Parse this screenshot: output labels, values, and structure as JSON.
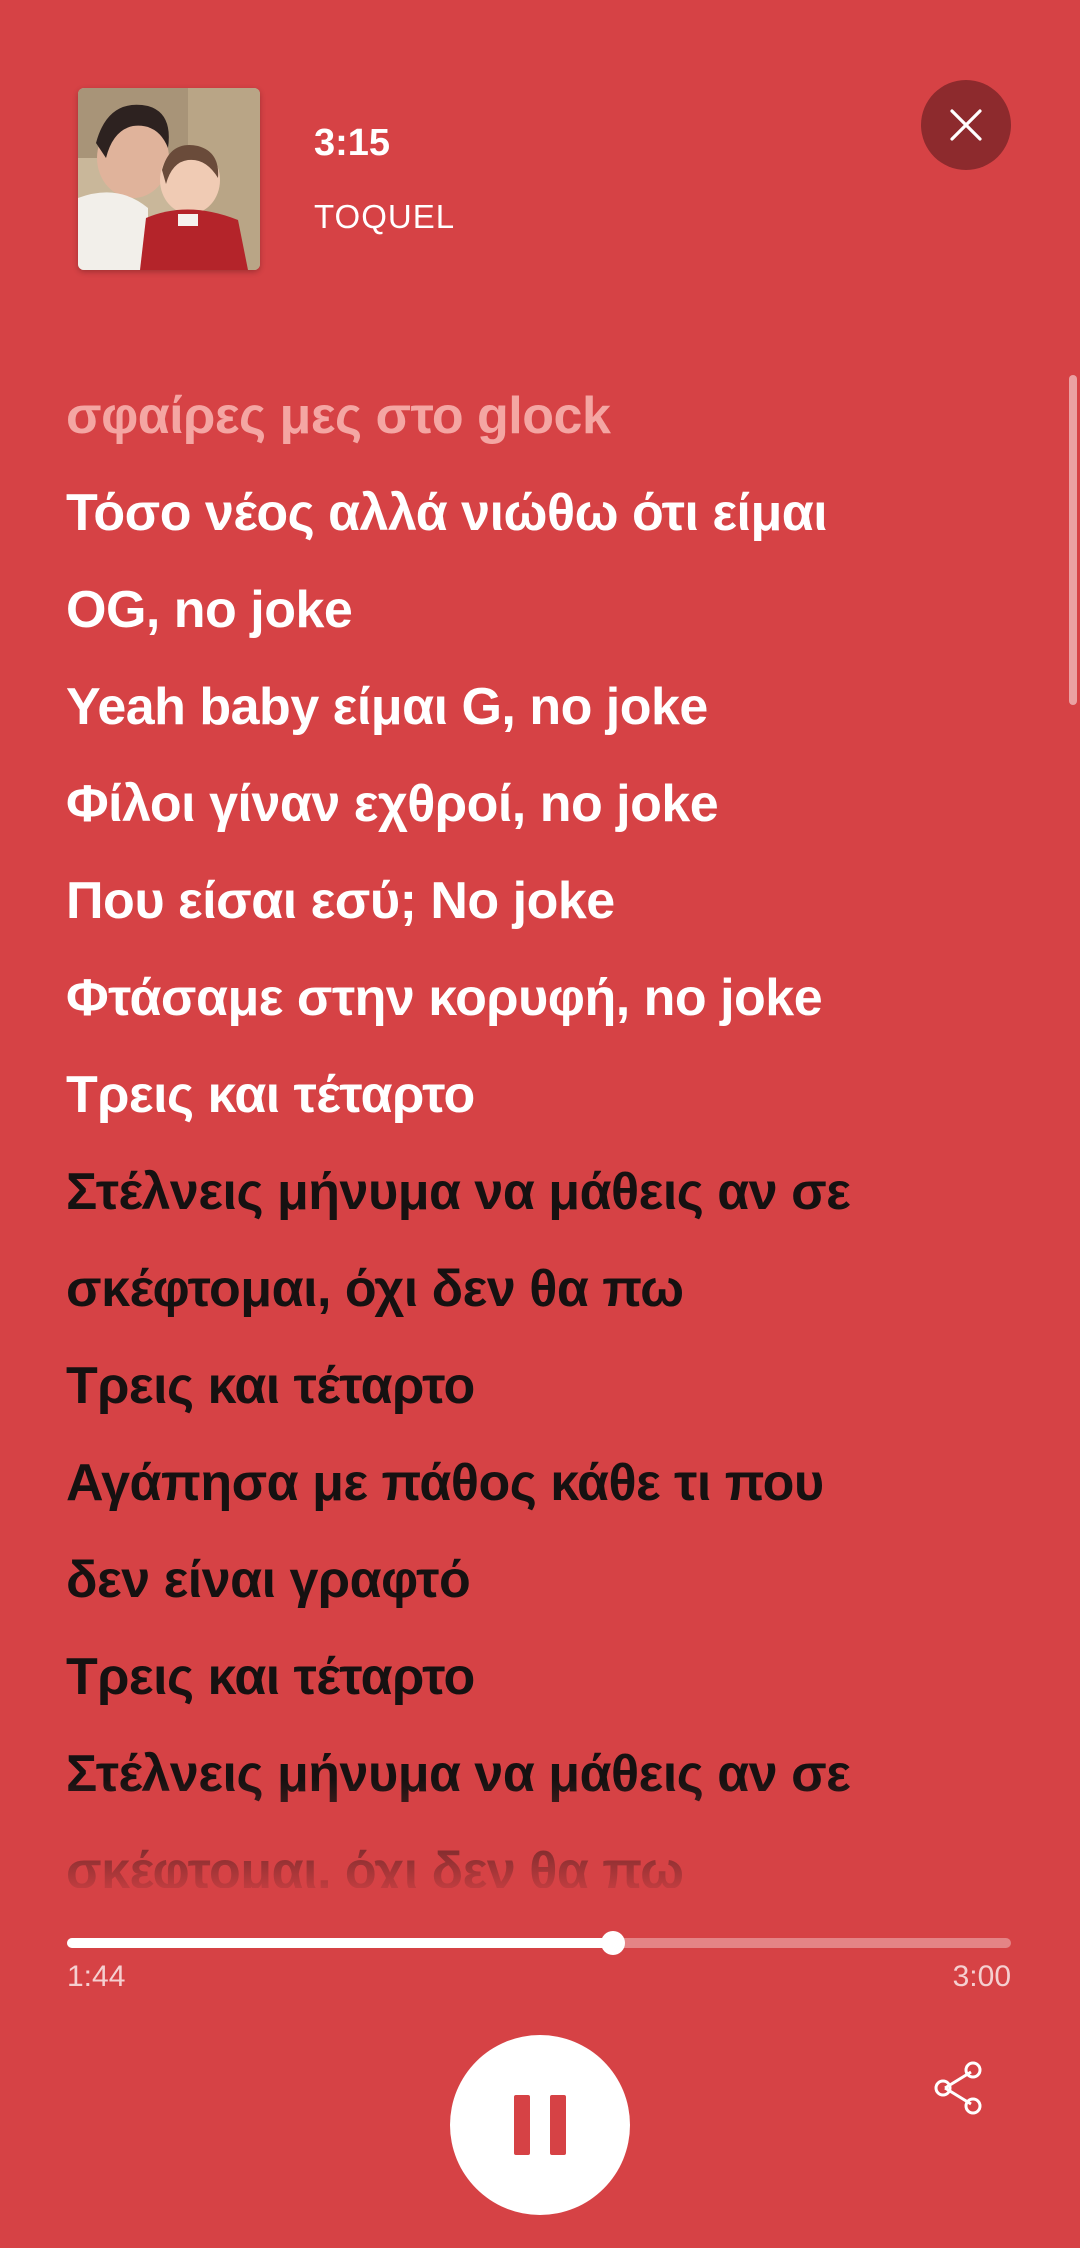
{
  "track": {
    "title": "3:15",
    "artist": "TOQUEL"
  },
  "icons": {
    "close": "close-icon",
    "pause": "pause-icon",
    "share": "share-icon"
  },
  "colors": {
    "background": "#d64245",
    "close_button": "#8d2a2d",
    "past_lyric": "#ffffff",
    "upcoming_lyric": "#161111",
    "faded_lyric": "#f4a6a3"
  },
  "lyrics": [
    {
      "text": "σφαίρες μες στο glock",
      "state": "faded"
    },
    {
      "text": "Τόσο νέος αλλά νιώθω ότι είμαι",
      "state": "past"
    },
    {
      "text": "OG, no joke",
      "state": "past"
    },
    {
      "text": "Yeah baby είμαι G, no joke",
      "state": "past"
    },
    {
      "text": "Φίλοι γίναν εχθροί, no joke",
      "state": "past"
    },
    {
      "text": "Που είσαι εσύ; No joke",
      "state": "past"
    },
    {
      "text": "Φτάσαμε στην κορυφή, no joke",
      "state": "past"
    },
    {
      "text": "Τρεις και τέταρτο",
      "state": "past"
    },
    {
      "text": "Στέλνεις μήνυμα να μάθεις αν σε",
      "state": "future"
    },
    {
      "text": "σκέφτομαι, όχι δεν θα πω",
      "state": "future"
    },
    {
      "text": "Τρεις και τέταρτο",
      "state": "future"
    },
    {
      "text": "Αγάπησα με πάθος κάθε τι που",
      "state": "future"
    },
    {
      "text": "δεν είναι γραφτό",
      "state": "future"
    },
    {
      "text": "Τρεις και τέταρτο",
      "state": "future"
    },
    {
      "text": "Στέλνεις μήνυμα να μάθεις αν σε",
      "state": "future"
    },
    {
      "text": "σκέφτομαι, όχι δεν θα πω",
      "state": "future"
    }
  ],
  "playback": {
    "elapsed": "1:44",
    "total": "3:00",
    "progress": 0.578,
    "state": "playing"
  }
}
